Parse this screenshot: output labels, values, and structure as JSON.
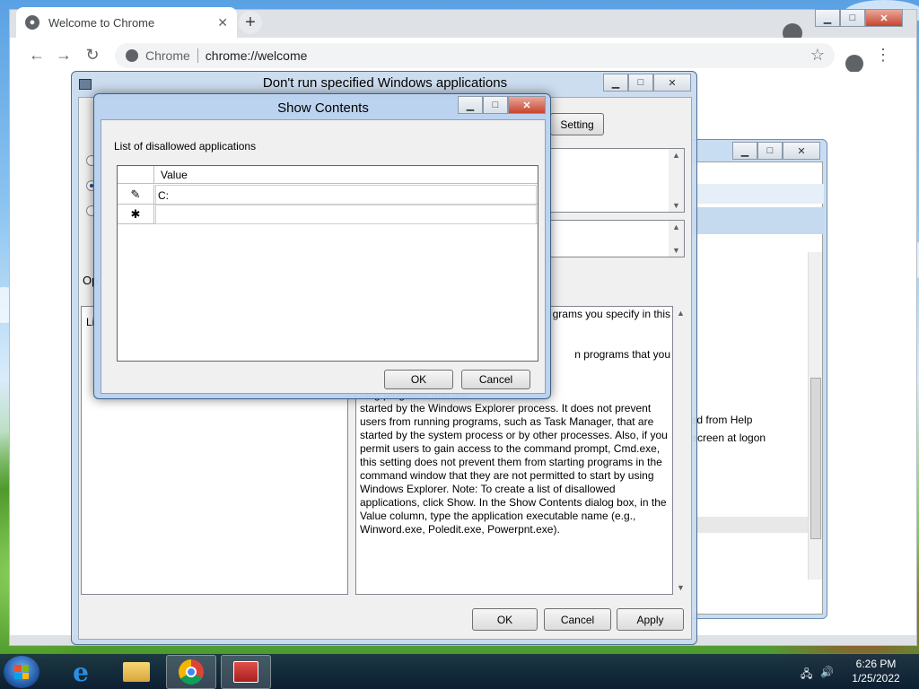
{
  "chrome": {
    "tab_title": "Welcome to Chrome",
    "tab_close": "✕",
    "new_tab": "+",
    "back": "←",
    "forward": "→",
    "reload": "↻",
    "scheme_label": "Chrome",
    "url": "chrome://welcome",
    "star": "☆",
    "menu": "⋮"
  },
  "policy_dialog": {
    "title": "Don't run specified Windows applications",
    "setting_button": "Setting",
    "options_label": "Op",
    "list_label": "Li",
    "help_lines": [
      "grams you specify in this",
      "",
      "",
      "n programs that you",
      "",
      "",
      "ning programs that are",
      "started by the Windows Explorer process. It does not prevent",
      "users from running programs, such as Task Manager, that are",
      "started by the system process or by other processes. Also, if you",
      "permit users to gain access to the command prompt, Cmd.exe,",
      "this setting does not prevent them from starting programs in the",
      "command window that they are not permitted to start by using",
      "Windows Explorer. Note: To create a list of disallowed",
      "applications, click Show. In the Show Contents dialog box, in the",
      "Value column, type the application executable name (e.g.,",
      "Winword.exe, Poledit.exe, Powerpnt.exe)."
    ],
    "ok": "OK",
    "cancel": "Cancel",
    "apply": "Apply"
  },
  "show_contents": {
    "title": "Show Contents",
    "list_label": "List of disallowed applications",
    "column_header": "Value",
    "rows": [
      {
        "marker": "✎",
        "value": "C:"
      },
      {
        "marker": "✱",
        "value": ""
      }
    ],
    "ok": "OK",
    "cancel": "Cancel"
  },
  "background_window": {
    "text1": "ned from Help",
    "text2": "screen at logon"
  },
  "taskbar": {
    "time": "6:26 PM",
    "date": "1/25/2022"
  },
  "window_controls": {
    "minimize": "▁",
    "maximize": "□",
    "close": "✕"
  }
}
